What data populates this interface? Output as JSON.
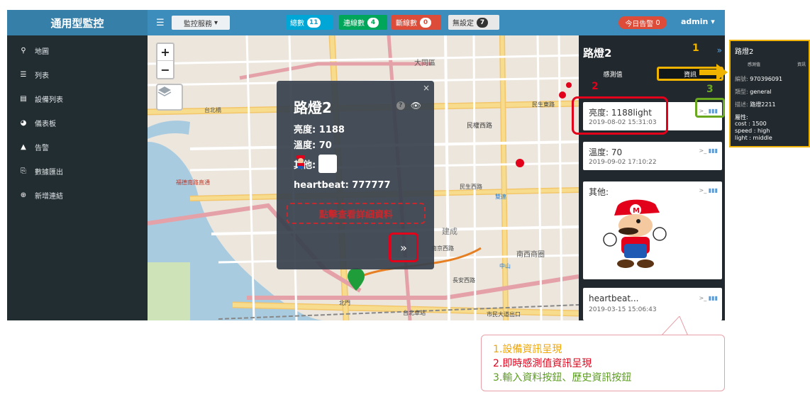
{
  "app": {
    "brand": "通用型監控",
    "service_select": "監控服務",
    "stats": {
      "total_label": "總數",
      "total_count": "11",
      "online_label": "連線數",
      "online_count": "4",
      "offline_label": "斷線數",
      "offline_count": "0",
      "unset_label": "無設定",
      "unset_count": "7"
    },
    "alarm_label": "今日告警",
    "alarm_count": "0",
    "user": "admin"
  },
  "sidebar": {
    "items": [
      {
        "label": "地圖",
        "icon": "map-pin-icon"
      },
      {
        "label": "列表",
        "icon": "list-icon"
      },
      {
        "label": "設備列表",
        "icon": "device-list-icon"
      },
      {
        "label": "儀表板",
        "icon": "dashboard-icon"
      },
      {
        "label": "告警",
        "icon": "warning-icon"
      },
      {
        "label": "數據匯出",
        "icon": "export-icon"
      },
      {
        "label": "新增連結",
        "icon": "add-circle-icon"
      }
    ]
  },
  "map": {
    "zoom_in": "+",
    "zoom_out": "−",
    "labels": {
      "datong": "大同區",
      "minquan": "民權西路",
      "minsheng": "民生西路",
      "minsheng_e": "民生東路",
      "nanjing": "南京西路",
      "changan": "長安西路",
      "bei": "北門",
      "taipei_station": "台北車站",
      "taipei_bridge": "台北橋",
      "nanxi": "南西商圈",
      "fude": "福德南路直通",
      "shuangfeng": "雙連",
      "zhongshan": "中山",
      "jiancheng": "建成",
      "ximen": "市民大道出口"
    }
  },
  "popup": {
    "title": "路燈2",
    "brightness": "亮度: 1188",
    "temperature": "溫度: 70",
    "other_label": "其他:",
    "heartbeat": "heartbeat: 777777",
    "detail_link": "點擊查看詳細資料",
    "close": "×",
    "next": "»"
  },
  "panel": {
    "title": "路燈2",
    "expand": "»",
    "tab_sensor": "感測值",
    "tab_info": "資訊",
    "cards": [
      {
        "title": "亮度: 1188light",
        "time": "2019-08-02 15:31:03"
      },
      {
        "title": "溫度: 70",
        "time": "2019-09-02 17:10:22"
      },
      {
        "title": "其他:",
        "time": ""
      },
      {
        "title": "heartbeat...",
        "time": "2019-03-15 15:06:43"
      }
    ],
    "action_input": ">_",
    "action_history": "▮▮▮"
  },
  "callouts": {
    "n1": "1",
    "n2": "2",
    "n3": "3"
  },
  "devinfo": {
    "title": "路燈2",
    "hdr_sensor": "感測值",
    "hdr_info": "資訊",
    "id_label": "編號:",
    "id_value": "970396091",
    "type_label": "類型:",
    "type_value": "general",
    "desc_label": "描述:",
    "desc_value": "路燈2211",
    "attr_label": "屬性:",
    "attr1": "cost : 1500",
    "attr2": "speed : high",
    "attr3": "light : middle"
  },
  "legend": {
    "line1": "1.設備資訊呈現",
    "line2": "2.即時感測值資訊呈現",
    "line3": "3.輸入資料按鈕、歷史資訊按鈕"
  },
  "colors": {
    "header": "#3c8dbc",
    "sidebar": "#222d32",
    "highlight_yellow": "#f0b400",
    "highlight_red": "#e2001a",
    "highlight_green": "#6aa91f"
  }
}
